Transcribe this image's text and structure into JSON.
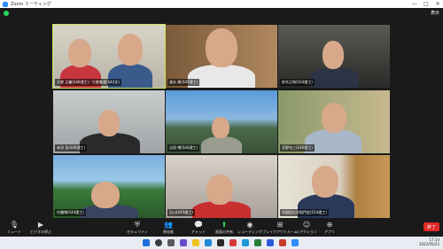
{
  "window": {
    "title": "Zoom ミーティング",
    "minimize": "—",
    "maximize": "□",
    "close": "✕"
  },
  "view_button": "表示",
  "participants": [
    {
      "name": "大野 正義(S46理工)／大野美喜(S42文)"
    },
    {
      "name": "清水 勇(S45理工)"
    },
    {
      "name": "鈴木正和(S54理工)"
    },
    {
      "name": "赤羽 浩(S46理工)"
    },
    {
      "name": "吉田 博(S44理工)"
    },
    {
      "name": "宮野光三(S46理工)"
    },
    {
      "name": "村瀬博(S44理工)"
    },
    {
      "name": "石川(S45理工)"
    },
    {
      "name": "早稲田大学稲門会(S54理工)"
    }
  ],
  "toolbar": {
    "items": [
      {
        "label": "ミュート",
        "icon": "microphone-icon"
      },
      {
        "label": "ビデオの停止",
        "icon": "video-camera-icon"
      },
      {
        "label": "セキュリティ",
        "icon": "shield-icon"
      },
      {
        "label": "参加者",
        "icon": "participants-icon",
        "count": "9"
      },
      {
        "label": "チャット",
        "icon": "chat-icon"
      },
      {
        "label": "画面の共有",
        "icon": "share-screen-icon"
      },
      {
        "label": "レコーディング",
        "icon": "record-icon"
      },
      {
        "label": "ブレイクアウトルーム",
        "icon": "breakout-icon"
      },
      {
        "label": "リアクション",
        "icon": "reaction-icon"
      },
      {
        "label": "アプリ",
        "icon": "apps-icon"
      }
    ],
    "end_label": "終了"
  },
  "taskbar": {
    "time": "17:14",
    "date": "2022/05/22"
  },
  "colors": {
    "accent": "#2d8cff",
    "end": "#e02828",
    "active_border": "#c8e64b",
    "share": "#23d959"
  }
}
